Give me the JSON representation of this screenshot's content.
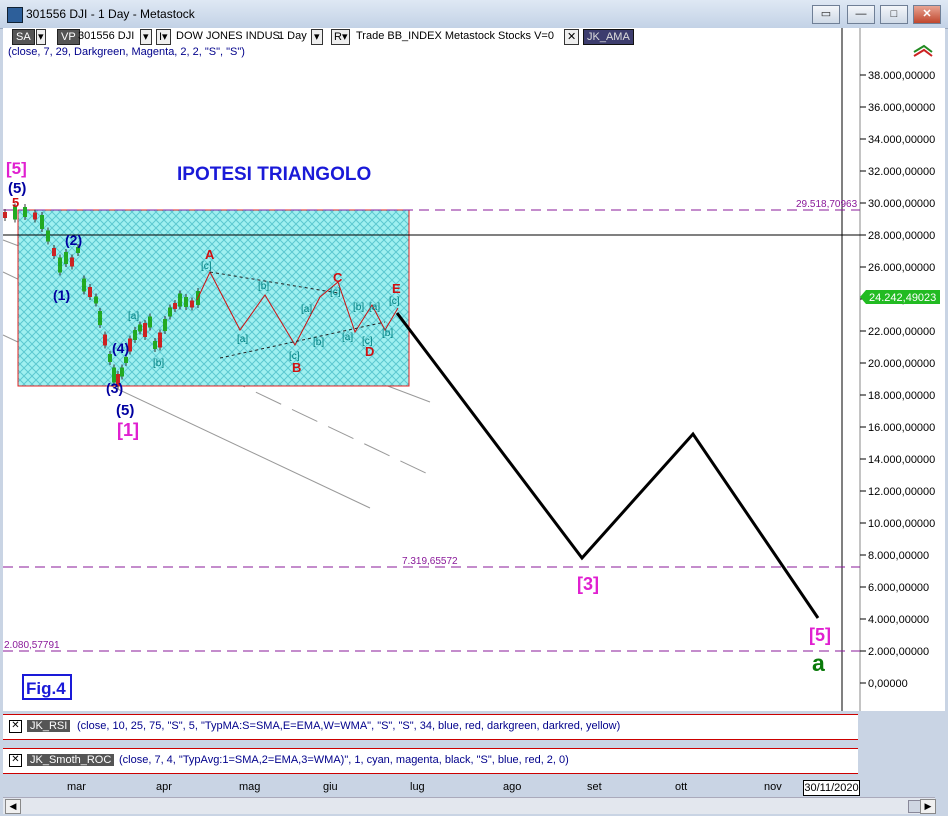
{
  "window": {
    "title": "301556 DJI - 1 Day - Metastock",
    "btn_restore_label": "▭",
    "btn_min_label": "—",
    "btn_max_label": "□",
    "btn_close_label": "✕"
  },
  "toolbar": {
    "sa_label": "SA",
    "vp_label": "VP",
    "symbol": "301556 DJI",
    "dd1_label": "▾",
    "dd2_label": "I▾",
    "name": "DOW JONES INDUS",
    "period": "1 Day",
    "dd3_label": "▾",
    "r_label": "R▾",
    "trade_text": "Trade  BB_INDEX  Metastock  Stocks  V=0",
    "x_label": "✕",
    "indicator": "JK_AMA"
  },
  "params_line": "(close,  7,  29,  Darkgreen,  Magenta,  2,  2,  \"S\",  \"S\")",
  "annotations": {
    "main_title": "IPOTESI TRIANGOLO",
    "fig_label": "Fig.4",
    "level_high": "29.518,70963",
    "level_mid": "7.319,65572",
    "level_low": "2.080,57791",
    "current_price": "24.242,49023",
    "wave_5_top": "[5]",
    "wave_5_paren": "(5)",
    "wave_5_red": "5",
    "wave_1_br": "[1]",
    "wave_5_paren_low": "(5)",
    "wave_3_paren": "(3)",
    "wave_4_paren": "(4)",
    "wave_2_paren": "(2)",
    "wave_1_paren": "(1)",
    "wave_3_br": "[3]",
    "wave_5_br_bottom": "[5]",
    "wave_a_green": "a",
    "tri_A": "A",
    "tri_B": "B",
    "tri_C": "C",
    "tri_D": "D",
    "tri_E": "E",
    "sub_a1": "[a]",
    "sub_b1": "[b]",
    "sub_a2": "[a]",
    "sub_c1": "[c]",
    "sub_b2": "[b]",
    "sub_a3": "[a]",
    "sub_c2": "[c]",
    "sub_b3": "[b]",
    "sub_c3": "[c]",
    "sub_a4": "[a]",
    "sub_b4": "[b]",
    "sub_a5": "[a]",
    "sub_b5": "[b]",
    "sub_c4": "[c]",
    "sub_a6": "[a]",
    "sub_b6": "[b]",
    "sub_c5": "[c]",
    "sub_c6": "[c]"
  },
  "price_axis": {
    "labels": [
      "38.000,00000",
      "36.000,00000",
      "34.000,00000",
      "32.000,00000",
      "30.000,00000",
      "28.000,00000",
      "26.000,00000",
      "24.000,00000",
      "22.000,00000",
      "20.000,00000",
      "18.000,00000",
      "16.000,00000",
      "14.000,00000",
      "12.000,00000",
      "10.000,00000",
      "8.000,00000",
      "6.000,00000",
      "4.000,00000",
      "2.000,00000",
      "0,00000"
    ]
  },
  "panels": {
    "rsi": {
      "x_label": "✕",
      "name": "JK_RSI",
      "params": "(close,  10,  25,  75,  \"S\",  5,  \"TypMA:S=SMA,E=EMA,W=WMA\",  \"S\",  \"S\",  34,  blue,  red,  darkgreen,  darkred,  yellow)"
    },
    "roc": {
      "x_label": "✕",
      "name": "JK_Smoth_ROC",
      "params": "(close,  7,  4,  \"TypAvg:1=SMA,2=EMA,3=WMA)\",  1,  cyan,  magenta,  black,  \"S\",  blue,  red,  2,  0)"
    }
  },
  "date_axis": {
    "months": [
      "mar",
      "apr",
      "mag",
      "giu",
      "lug",
      "ago",
      "set",
      "ott",
      "nov"
    ],
    "current_date": "30/11/2020"
  },
  "colors": {
    "wave_magenta": "#e020d0",
    "wave_blue": "#0000a0",
    "wave_red": "#d01010",
    "sub_teal": "#008080",
    "title_blue": "#1a1ad8",
    "level_purple": "#8a1a9a",
    "price_green": "#22bb22",
    "a_green": "#0a7a0a"
  },
  "scrollbar": {
    "left_arrow": "◀",
    "right_arrow": "▶"
  }
}
